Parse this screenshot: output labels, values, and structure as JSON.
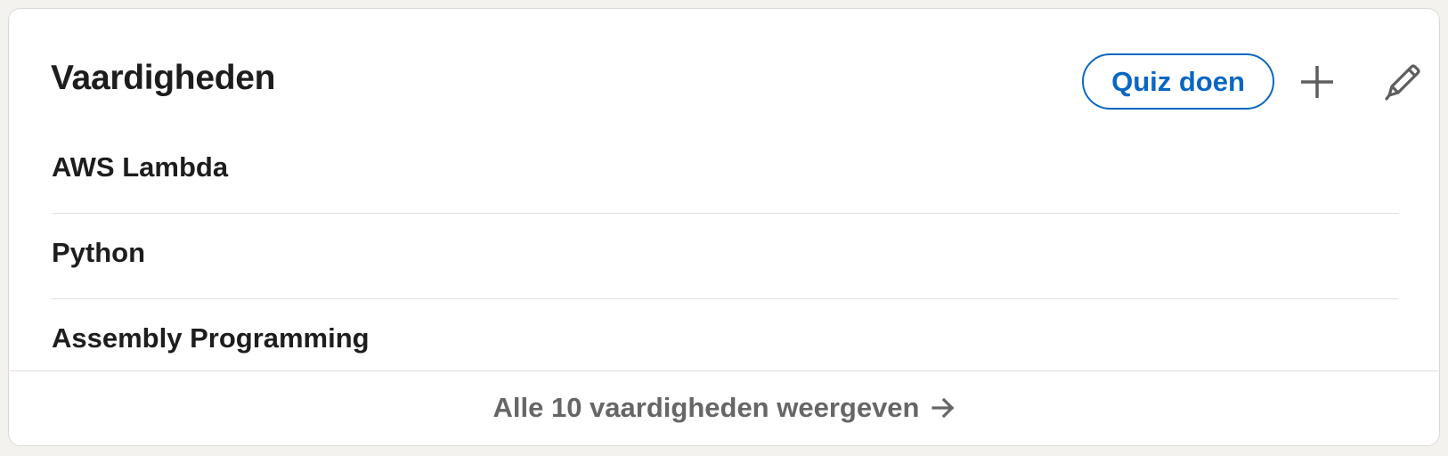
{
  "section": {
    "title": "Vaardigheden",
    "quiz_label": "Quiz doen",
    "add_icon": "plus-icon",
    "edit_icon": "pencil-icon"
  },
  "skills": [
    {
      "name": "AWS Lambda"
    },
    {
      "name": "Python"
    },
    {
      "name": "Assembly Programming"
    }
  ],
  "footer": {
    "show_all_label": "Alle 10 vaardigheden weergeven",
    "arrow_icon": "arrow-right-icon"
  },
  "colors": {
    "accent": "#0a66c2",
    "text": "#1d1d1d",
    "muted": "#666666",
    "background": "#f3f2ef",
    "card": "#ffffff"
  }
}
